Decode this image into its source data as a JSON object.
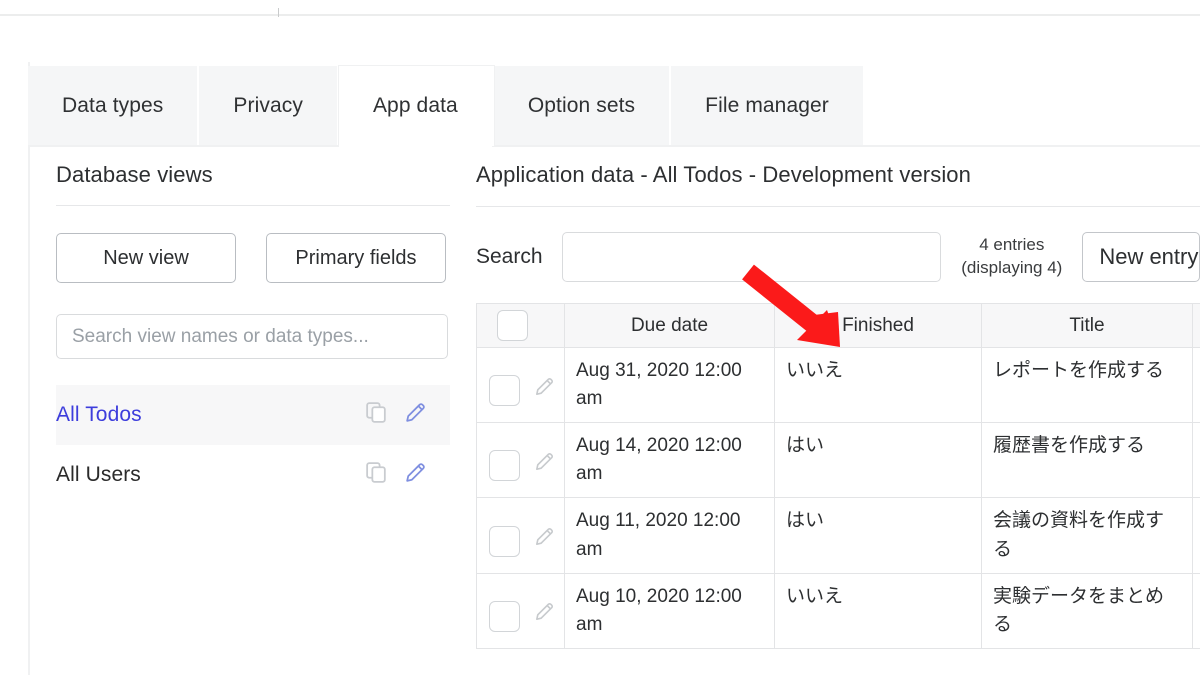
{
  "tabs": [
    {
      "label": "Data types",
      "active": false
    },
    {
      "label": "Privacy",
      "active": false
    },
    {
      "label": "App data",
      "active": true
    },
    {
      "label": "Option sets",
      "active": false
    },
    {
      "label": "File manager",
      "active": false
    }
  ],
  "sidebar": {
    "title": "Database views",
    "new_view_label": "New view",
    "primary_fields_label": "Primary fields",
    "search_placeholder": "Search view names or data types...",
    "search_value": "",
    "items": [
      {
        "label": "All Todos",
        "selected": true
      },
      {
        "label": "All Users",
        "selected": false
      }
    ],
    "icons": {
      "duplicate": "duplicate-icon",
      "edit": "pencil-icon"
    },
    "selected_color": "#3d3ddc"
  },
  "main": {
    "title": "Application data - All Todos - Development version",
    "search_label": "Search",
    "search_placeholder": "",
    "search_value": "",
    "entries_count": "4 entries",
    "entries_displaying": "(displaying 4)",
    "new_entry_label": "New entry"
  },
  "table": {
    "columns": [
      "",
      "Due date",
      "Finished",
      "Title",
      ""
    ],
    "rows": [
      {
        "due_date": "Aug 31, 2020 12:00 am",
        "finished": "いいえ",
        "title": "レポートを作成する",
        "extra": "",
        "checked": false
      },
      {
        "due_date": "Aug 14, 2020 12:00 am",
        "finished": "はい",
        "title": "履歴書を作成する",
        "extra": "",
        "checked": false
      },
      {
        "due_date": "Aug 11, 2020 12:00 am",
        "finished": "はい",
        "title": "会議の資料を作成する",
        "extra": "",
        "checked": false
      },
      {
        "due_date": "Aug 10, 2020 12:00 am",
        "finished": "いいえ",
        "title": "実験データをまとめる",
        "extra": "",
        "checked": false
      }
    ]
  },
  "annotation": {
    "arrow_color": "#fb1a1a",
    "target": "Finished"
  }
}
